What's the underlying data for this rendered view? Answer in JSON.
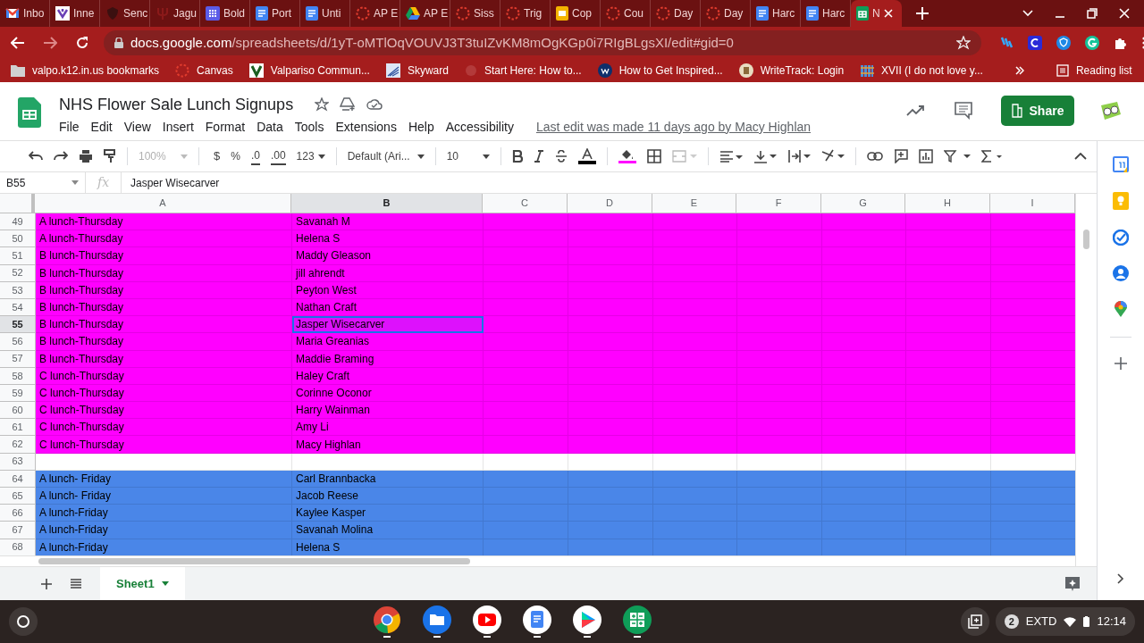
{
  "browser_tabs": [
    {
      "title": "Inbo",
      "selected": false
    },
    {
      "title": "Inne",
      "selected": false
    },
    {
      "title": "Senc",
      "selected": false
    },
    {
      "title": "Jagu",
      "selected": false
    },
    {
      "title": "Bold",
      "selected": false
    },
    {
      "title": "Port",
      "selected": false
    },
    {
      "title": "Unti",
      "selected": false
    },
    {
      "title": "AP E",
      "selected": false
    },
    {
      "title": "AP E",
      "selected": false
    },
    {
      "title": "Siss",
      "selected": false
    },
    {
      "title": "Trig",
      "selected": false
    },
    {
      "title": "Cop",
      "selected": false
    },
    {
      "title": "Cou",
      "selected": false
    },
    {
      "title": "Day",
      "selected": false
    },
    {
      "title": "Day",
      "selected": false
    },
    {
      "title": "Harc",
      "selected": false
    },
    {
      "title": "Harc",
      "selected": false
    },
    {
      "title": "N",
      "selected": true
    }
  ],
  "address": {
    "host": "docs.google.com",
    "path": "/spreadsheets/d/1yT-oMTlOqVOUVJ3T3tuIZvKM8mOgKGp0i7RIgBLgsXI/edit#gid=0"
  },
  "bookmarks": [
    {
      "label": "valpo.k12.in.us bookmarks"
    },
    {
      "label": "Canvas"
    },
    {
      "label": "Valpariso Commun..."
    },
    {
      "label": "Skyward"
    },
    {
      "label": "Start Here: How to..."
    },
    {
      "label": "How to Get Inspired..."
    },
    {
      "label": "WriteTrack: Login"
    },
    {
      "label": "XVII (I do not love y..."
    }
  ],
  "reading_list": "Reading list",
  "doc": {
    "title": "NHS Flower Sale Lunch Signups",
    "menus": [
      "File",
      "Edit",
      "View",
      "Insert",
      "Format",
      "Data",
      "Tools",
      "Extensions",
      "Help",
      "Accessibility"
    ],
    "last_edit": "Last edit was made 11 days ago by Macy Highlan",
    "share": "Share"
  },
  "toolbar": {
    "zoom": "100%",
    "currency": "$",
    "percent": "%",
    "dec_less": ".0",
    "dec_more": ".00",
    "format": "123",
    "font": "Default (Ari...",
    "size": "10"
  },
  "formula_bar": {
    "cell": "B55",
    "function_label": "fx",
    "value": "Jasper Wisecarver"
  },
  "columns": [
    {
      "label": "A",
      "selected": false
    },
    {
      "label": "B",
      "selected": true
    },
    {
      "label": "C",
      "selected": false
    },
    {
      "label": "D",
      "selected": false
    },
    {
      "label": "E",
      "selected": false
    },
    {
      "label": "F",
      "selected": false
    },
    {
      "label": "G",
      "selected": false
    },
    {
      "label": "H",
      "selected": false
    },
    {
      "label": "I",
      "selected": false
    }
  ],
  "rows": [
    {
      "number": "49",
      "a": "A lunch-Thursday",
      "b": "Savanah M",
      "color": "#ff00ff",
      "selected": false
    },
    {
      "number": "50",
      "a": "A lunch-Thursday",
      "b": "Helena S",
      "color": "#ff00ff",
      "selected": false
    },
    {
      "number": "51",
      "a": "B lunch-Thursday",
      "b": "Maddy Gleason",
      "color": "#ff00ff",
      "selected": false
    },
    {
      "number": "52",
      "a": "B lunch-Thursday",
      "b": "jill ahrendt",
      "color": "#ff00ff",
      "selected": false
    },
    {
      "number": "53",
      "a": "B lunch-Thursday",
      "b": "Peyton West",
      "color": "#ff00ff",
      "selected": false
    },
    {
      "number": "54",
      "a": "B lunch-Thursday",
      "b": "Nathan Craft",
      "color": "#ff00ff",
      "selected": false
    },
    {
      "number": "55",
      "a": "B lunch-Thursday",
      "b": "Jasper Wisecarver",
      "color": "#ff00ff",
      "selected": true
    },
    {
      "number": "56",
      "a": "B lunch-Thursday",
      "b": "Maria Greanias",
      "color": "#ff00ff",
      "selected": false
    },
    {
      "number": "57",
      "a": "B lunch-Thursday",
      "b": "Maddie Braming",
      "color": "#ff00ff",
      "selected": false
    },
    {
      "number": "58",
      "a": "C lunch-Thursday",
      "b": "Haley Craft",
      "color": "#ff00ff",
      "selected": false
    },
    {
      "number": "59",
      "a": "C lunch-Thursday",
      "b": "Corinne Oconor",
      "color": "#ff00ff",
      "selected": false
    },
    {
      "number": "60",
      "a": "C lunch-Thursday",
      "b": "Harry Wainman",
      "color": "#ff00ff",
      "selected": false
    },
    {
      "number": "61",
      "a": "C lunch-Thursday",
      "b": "Amy Li",
      "color": "#ff00ff",
      "selected": false
    },
    {
      "number": "62",
      "a": "C lunch-Thursday",
      "b": "Macy Highlan",
      "color": "#ff00ff",
      "selected": false
    },
    {
      "number": "63",
      "color": "#ffffff",
      "selected": false
    },
    {
      "number": "64",
      "a": "A lunch- Friday",
      "b": "Carl Brannbacka",
      "color": "#4a86e8",
      "selected": false
    },
    {
      "number": "65",
      "a": "A lunch- Friday",
      "b": "Jacob Reese",
      "color": "#4a86e8",
      "selected": false
    },
    {
      "number": "66",
      "a": "A lunch-Friday",
      "b": "Kaylee Kasper",
      "color": "#4a86e8",
      "selected": false
    },
    {
      "number": "67",
      "a": "A lunch-Friday",
      "b": "Savanah Molina",
      "color": "#4a86e8",
      "selected": false
    },
    {
      "number": "68",
      "a": "A lunch-Friday",
      "b": "Helena S",
      "color": "#4a86e8",
      "selected": false
    }
  ],
  "sheets": [
    {
      "label": "Sheet1",
      "selected": true
    }
  ],
  "shelf": {
    "notifications": "2",
    "display": "EXTD",
    "time": "12:14"
  }
}
